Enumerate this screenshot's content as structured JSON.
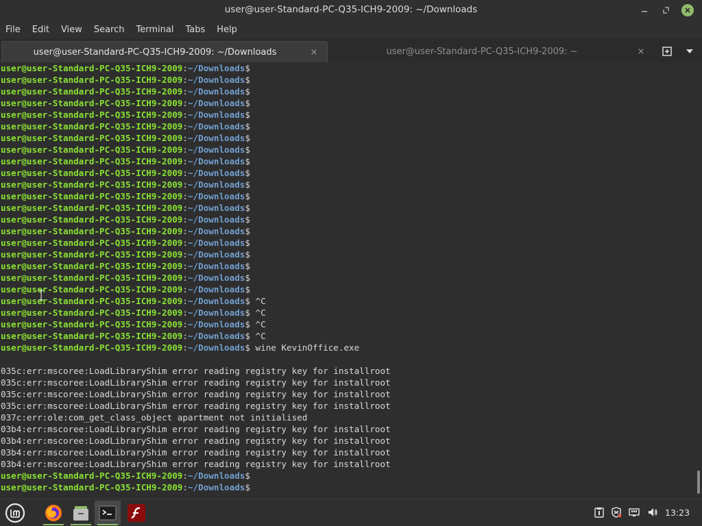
{
  "window": {
    "title": "user@user-Standard-PC-Q35-ICH9-2009: ~/Downloads",
    "minimize_icon": "minimize-icon",
    "maximize_icon": "maximize-icon",
    "close_icon": "close-icon"
  },
  "menu": [
    "File",
    "Edit",
    "View",
    "Search",
    "Terminal",
    "Tabs",
    "Help"
  ],
  "tabs": [
    {
      "label": "user@user-Standard-PC-Q35-ICH9-2009: ~/Downloads",
      "active": true,
      "close": "×"
    },
    {
      "label": "user@user-Standard-PC-Q35-ICH9-2009: ~",
      "active": false,
      "close": "×"
    }
  ],
  "prompt": {
    "user": "user@user-Standard-PC-Q35-ICH9-2009",
    "sep": ":",
    "path": "~/Downloads",
    "dollar": "$"
  },
  "terminal_lines": [
    {
      "type": "prompt",
      "cmd": ""
    },
    {
      "type": "prompt",
      "cmd": ""
    },
    {
      "type": "prompt",
      "cmd": ""
    },
    {
      "type": "prompt",
      "cmd": ""
    },
    {
      "type": "prompt",
      "cmd": ""
    },
    {
      "type": "prompt",
      "cmd": ""
    },
    {
      "type": "prompt",
      "cmd": ""
    },
    {
      "type": "prompt",
      "cmd": ""
    },
    {
      "type": "prompt",
      "cmd": ""
    },
    {
      "type": "prompt",
      "cmd": ""
    },
    {
      "type": "prompt",
      "cmd": ""
    },
    {
      "type": "prompt",
      "cmd": ""
    },
    {
      "type": "prompt",
      "cmd": ""
    },
    {
      "type": "prompt",
      "cmd": ""
    },
    {
      "type": "prompt",
      "cmd": ""
    },
    {
      "type": "prompt",
      "cmd": ""
    },
    {
      "type": "prompt",
      "cmd": ""
    },
    {
      "type": "prompt",
      "cmd": ""
    },
    {
      "type": "prompt",
      "cmd": ""
    },
    {
      "type": "prompt",
      "cmd": ""
    },
    {
      "type": "prompt",
      "cmd": " ^C"
    },
    {
      "type": "prompt",
      "cmd": " ^C"
    },
    {
      "type": "prompt",
      "cmd": " ^C"
    },
    {
      "type": "prompt",
      "cmd": " ^C"
    },
    {
      "type": "prompt",
      "cmd": " wine KevinOffice.exe"
    },
    {
      "type": "output",
      "text": ""
    },
    {
      "type": "output",
      "text": "035c:err:mscoree:LoadLibraryShim error reading registry key for installroot"
    },
    {
      "type": "output",
      "text": "035c:err:mscoree:LoadLibraryShim error reading registry key for installroot"
    },
    {
      "type": "output",
      "text": "035c:err:mscoree:LoadLibraryShim error reading registry key for installroot"
    },
    {
      "type": "output",
      "text": "035c:err:mscoree:LoadLibraryShim error reading registry key for installroot"
    },
    {
      "type": "output",
      "text": "037c:err:ole:com_get_class_object apartment not initialised"
    },
    {
      "type": "output",
      "text": "03b4:err:mscoree:LoadLibraryShim error reading registry key for installroot"
    },
    {
      "type": "output",
      "text": "03b4:err:mscoree:LoadLibraryShim error reading registry key for installroot"
    },
    {
      "type": "output",
      "text": "03b4:err:mscoree:LoadLibraryShim error reading registry key for installroot"
    },
    {
      "type": "output",
      "text": "03b4:err:mscoree:LoadLibraryShim error reading registry key for installroot"
    },
    {
      "type": "prompt",
      "cmd": ""
    },
    {
      "type": "prompt",
      "cmd": ""
    }
  ],
  "taskbar": {
    "clock": "13:23",
    "apps": [
      {
        "name": "menu-mint-icon"
      },
      {
        "name": "firefox-icon"
      },
      {
        "name": "files-icon"
      },
      {
        "name": "terminal-icon"
      },
      {
        "name": "flash-icon"
      }
    ]
  },
  "colors": {
    "user": "#8ae234",
    "path": "#729fcf",
    "accent": "#8fbc6b"
  }
}
